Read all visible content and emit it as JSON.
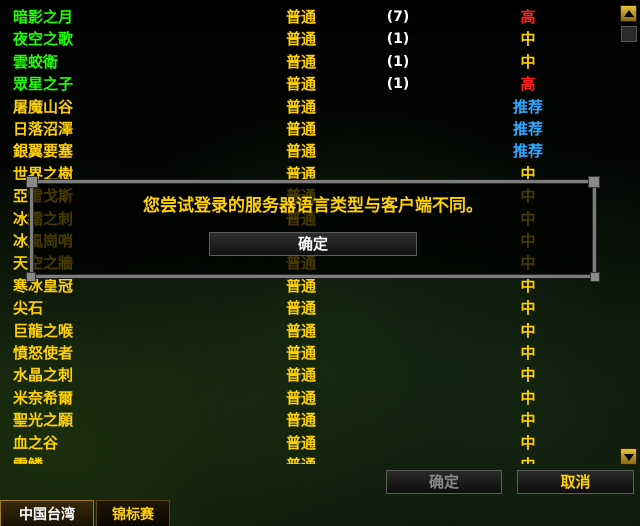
{
  "colors": {
    "name_green": "#1eff00",
    "name_yellow": "#ffd100",
    "type_yellow": "#ffd100",
    "pop_high": "#ff2020",
    "pop_medium": "#ffd100",
    "pop_recommended": "#2fa8ff"
  },
  "realms": [
    {
      "name": "暗影之月",
      "type": "普通",
      "chars": "(7)",
      "pop": "高",
      "name_color": "#1eff00",
      "pop_color": "#ff2020"
    },
    {
      "name": "夜空之歌",
      "type": "普通",
      "chars": "(1)",
      "pop": "中",
      "name_color": "#1eff00",
      "pop_color": "#ffd100"
    },
    {
      "name": "雲蛟衛",
      "type": "普通",
      "chars": "(1)",
      "pop": "中",
      "name_color": "#1eff00",
      "pop_color": "#ffd100"
    },
    {
      "name": "眾星之子",
      "type": "普通",
      "chars": "(1)",
      "pop": "高",
      "name_color": "#1eff00",
      "pop_color": "#ff2020"
    },
    {
      "name": "屠魔山谷",
      "type": "普通",
      "chars": "",
      "pop": "推荐",
      "name_color": "#ffd100",
      "pop_color": "#2fa8ff"
    },
    {
      "name": "日落沼澤",
      "type": "普通",
      "chars": "",
      "pop": "推荐",
      "name_color": "#ffd100",
      "pop_color": "#2fa8ff"
    },
    {
      "name": "銀翼要塞",
      "type": "普通",
      "chars": "",
      "pop": "推荐",
      "name_color": "#ffd100",
      "pop_color": "#2fa8ff"
    },
    {
      "name": "世界之樹",
      "type": "普通",
      "chars": "",
      "pop": "中",
      "name_color": "#ffd100",
      "pop_color": "#ffd100"
    },
    {
      "name": "亞雷戈斯",
      "type": "普通",
      "chars": "",
      "pop": "中",
      "name_color": "#ffd100",
      "pop_color": "#ffd100"
    },
    {
      "name": "冰霜之刺",
      "type": "普通",
      "chars": "",
      "pop": "中",
      "name_color": "#ffd100",
      "pop_color": "#ffd100"
    },
    {
      "name": "冰風崗哨",
      "type": "普通",
      "chars": "",
      "pop": "中",
      "name_color": "#ffd100",
      "pop_color": "#ffd100"
    },
    {
      "name": "天空之牆",
      "type": "普通",
      "chars": "",
      "pop": "中",
      "name_color": "#ffd100",
      "pop_color": "#ffd100"
    },
    {
      "name": "寒冰皇冠",
      "type": "普通",
      "chars": "",
      "pop": "中",
      "name_color": "#ffd100",
      "pop_color": "#ffd100"
    },
    {
      "name": "尖石",
      "type": "普通",
      "chars": "",
      "pop": "中",
      "name_color": "#ffd100",
      "pop_color": "#ffd100"
    },
    {
      "name": "巨龍之喉",
      "type": "普通",
      "chars": "",
      "pop": "中",
      "name_color": "#ffd100",
      "pop_color": "#ffd100"
    },
    {
      "name": "憤怒使者",
      "type": "普通",
      "chars": "",
      "pop": "中",
      "name_color": "#ffd100",
      "pop_color": "#ffd100"
    },
    {
      "name": "水晶之刺",
      "type": "普通",
      "chars": "",
      "pop": "中",
      "name_color": "#ffd100",
      "pop_color": "#ffd100"
    },
    {
      "name": "米奈希爾",
      "type": "普通",
      "chars": "",
      "pop": "中",
      "name_color": "#ffd100",
      "pop_color": "#ffd100"
    },
    {
      "name": "聖光之願",
      "type": "普通",
      "chars": "",
      "pop": "中",
      "name_color": "#ffd100",
      "pop_color": "#ffd100"
    },
    {
      "name": "血之谷",
      "type": "普通",
      "chars": "",
      "pop": "中",
      "name_color": "#ffd100",
      "pop_color": "#ffd100"
    },
    {
      "name": "雷鱗",
      "type": "普通",
      "chars": "",
      "pop": "中",
      "name_color": "#ffd100",
      "pop_color": "#ffd100"
    }
  ],
  "dialog": {
    "message": "您尝试登录的服务器语言类型与客户端不同。",
    "ok_label": "确定"
  },
  "footer": {
    "ok_label": "确定",
    "cancel_label": "取消"
  },
  "tabs": [
    {
      "label": "中国台湾"
    },
    {
      "label": "锦标赛"
    }
  ]
}
